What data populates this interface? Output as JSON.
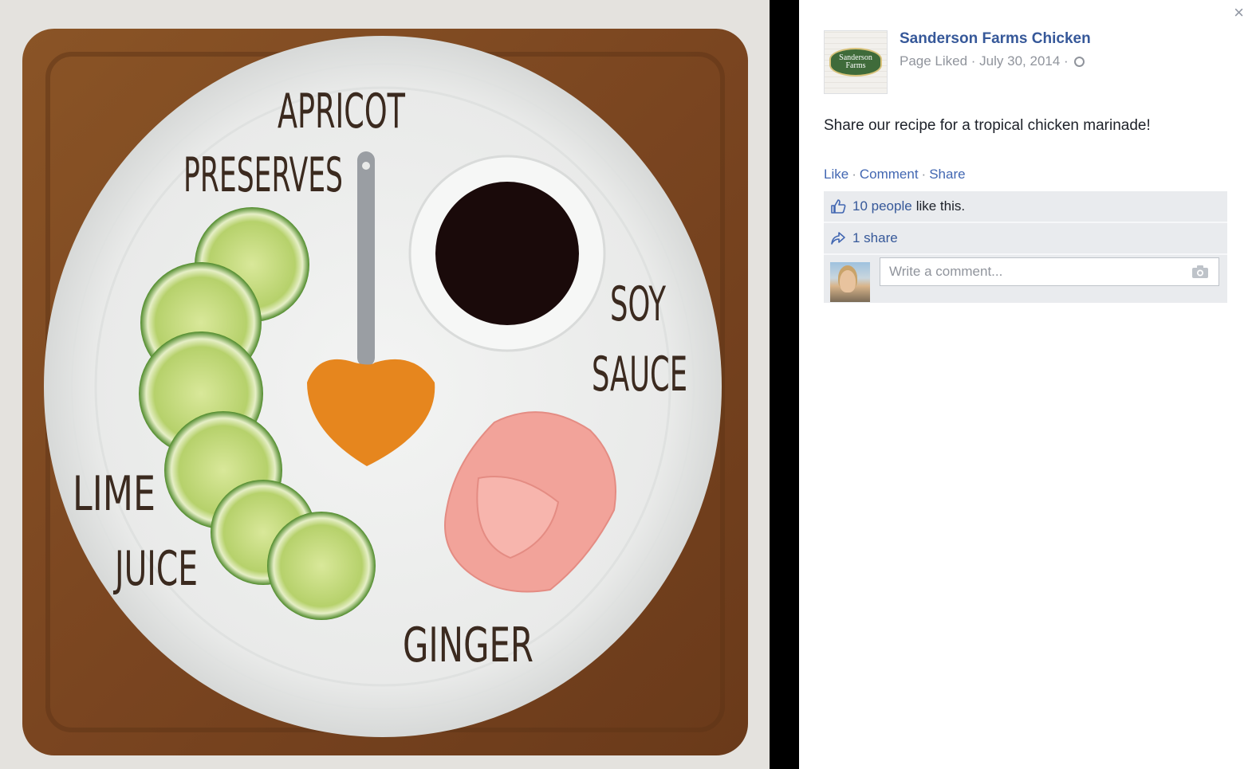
{
  "photo": {
    "labels": {
      "apricot": "APRICOT",
      "preserves": "PRESERVES",
      "soy": "SOY",
      "sauce": "SAUCE",
      "lime": "LIME",
      "juice": "JUICE",
      "ginger": "GINGER"
    }
  },
  "sidebar": {
    "close_label": "×",
    "page_name": "Sanderson Farms Chicken",
    "logo_text": "Sanderson Farms",
    "meta_text": "Page Liked · July 30, 2014 · ",
    "post_text": "Share our recipe for a tropical chicken marinade!",
    "actions": {
      "like": "Like",
      "comment": "Comment",
      "share": "Share"
    },
    "likes": {
      "count_text": "10 people",
      "suffix": "like this."
    },
    "shares": {
      "text": "1 share"
    },
    "comment": {
      "placeholder": "Write a comment..."
    }
  },
  "colors": {
    "link": "#365899",
    "accent": "#4267b2",
    "ufi_bg": "#e9ebee"
  }
}
